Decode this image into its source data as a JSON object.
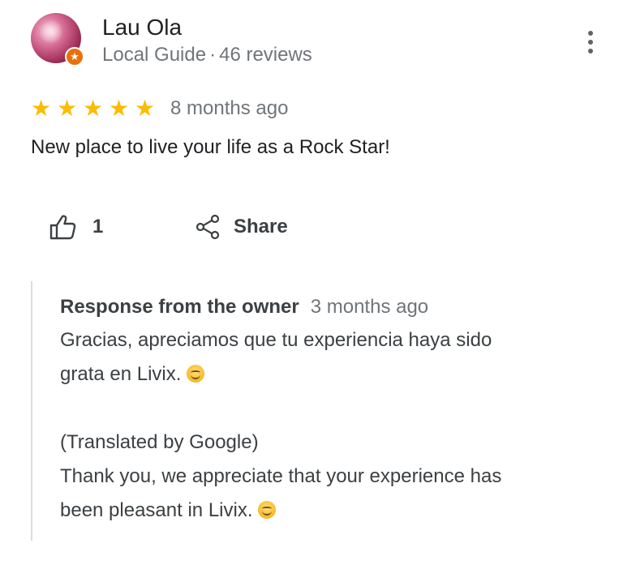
{
  "reviewer": {
    "name": "Lau Ola",
    "badge": "Local Guide",
    "separator": "·",
    "reviews": "46 reviews",
    "avatar_icon": "local-guide-avatar",
    "badge_color": "#e8710a"
  },
  "review": {
    "stars": [
      "★",
      "★",
      "★",
      "★",
      "★"
    ],
    "rating": 5,
    "star_color": "#fbbc04",
    "time": "8 months ago",
    "text": "New place to live your life as a Rock Star!"
  },
  "actions": {
    "like_icon": "thumbs-up-icon",
    "like_count": "1",
    "share_icon": "share-icon",
    "share_label": "Share"
  },
  "owner_response": {
    "title": "Response from the owner",
    "time": "3 months ago",
    "original_line1": "Gracias, apreciamos que tu experiencia haya sido",
    "original_line2": "grata en Livix.",
    "translated_label": "(Translated by Google)",
    "translated_line1": "Thank you, we appreciate that your experience has",
    "translated_line2": "been pleasant in Livix.",
    "emoji": "smiling-face-emoji"
  }
}
